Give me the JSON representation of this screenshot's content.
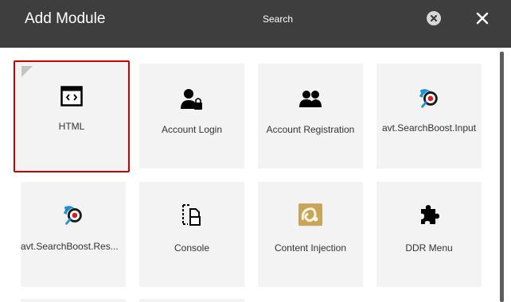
{
  "header": {
    "title": "Add Module",
    "search_placeholder": "Search"
  },
  "modules": [
    {
      "label": "HTML",
      "icon": "html-icon",
      "selected": true
    },
    {
      "label": "Account Login",
      "icon": "user-lock-icon"
    },
    {
      "label": "Account Registration",
      "icon": "users-icon"
    },
    {
      "label": "avt.SearchBoost.Input",
      "icon": "searchboost-icon"
    },
    {
      "label": "avt.SearchBoost.Res...",
      "icon": "searchboost-icon"
    },
    {
      "label": "Console",
      "icon": "console-icon"
    },
    {
      "label": "Content Injection",
      "icon": "content-injection-icon"
    },
    {
      "label": "DDR Menu",
      "icon": "puzzle-icon"
    }
  ],
  "colors": {
    "header_bg": "#3e3e3e",
    "tile_bg": "#f3f3f3",
    "selected_border": "#cc0000"
  }
}
